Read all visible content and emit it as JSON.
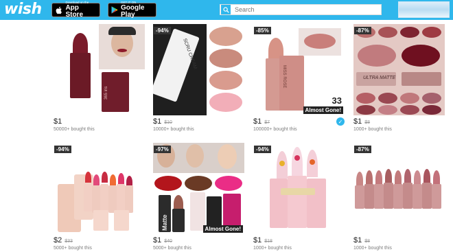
{
  "header": {
    "logo": "wish",
    "app_store": {
      "small": "Download on the",
      "big": "App Store"
    },
    "google_play": {
      "small": "GET IT ON",
      "big": "Google Play"
    },
    "search_placeholder": "Search"
  },
  "colors": {
    "brand": "#2fb7ec",
    "badge": "#333333"
  },
  "products": [
    {
      "price": "$1",
      "original": "",
      "bought": "50000+ bought this",
      "discount": "",
      "gone": "",
      "count": "",
      "verified": false,
      "tube_label": "365 iris"
    },
    {
      "price": "$1",
      "original": "$10",
      "bought": "10000+ bought this",
      "discount": "-94%",
      "gone": "",
      "count": "",
      "verified": false,
      "tube_label": "SCRU CREAM"
    },
    {
      "price": "$1",
      "original": "$7",
      "bought": "100000+ bought this",
      "discount": "-85%",
      "gone": "Almost Gone!",
      "count": "33",
      "verified": true,
      "tube_label": "MISS ROSE"
    },
    {
      "price": "$1",
      "original": "$8",
      "bought": "1000+ bought this",
      "discount": "-87%",
      "gone": "",
      "count": "",
      "verified": false,
      "tube_label": "ULTRA MATTE"
    },
    {
      "price": "$2",
      "original": "$33",
      "bought": "5000+ bought this",
      "discount": "-94%",
      "gone": "",
      "count": "",
      "verified": false,
      "tube_label": ""
    },
    {
      "price": "$1",
      "original": "$40",
      "bought": "5000+ bought this",
      "discount": "-97%",
      "gone": "Almost Gone!",
      "count": "",
      "verified": false,
      "tube_label": "Matte"
    },
    {
      "price": "$1",
      "original": "$18",
      "bought": "1000+ bought this",
      "discount": "-94%",
      "gone": "",
      "count": "",
      "verified": false,
      "tube_label": ""
    },
    {
      "price": "$1",
      "original": "$8",
      "bought": "1000+ bought this",
      "discount": "-87%",
      "gone": "",
      "count": "",
      "verified": false,
      "tube_label": ""
    }
  ]
}
